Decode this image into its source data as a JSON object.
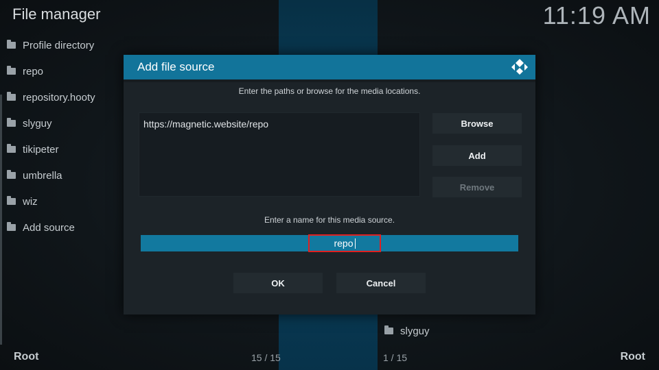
{
  "app_title": "File manager",
  "clock": "11:19 AM",
  "left_list": [
    {
      "label": "Profile directory"
    },
    {
      "label": "repo"
    },
    {
      "label": "repository.hooty"
    },
    {
      "label": "slyguy"
    },
    {
      "label": "tikipeter"
    },
    {
      "label": "umbrella"
    },
    {
      "label": "wiz"
    },
    {
      "label": "Add source"
    }
  ],
  "right_list": [
    {
      "label": "slyguy"
    }
  ],
  "footer": {
    "left_label": "Root",
    "left_count": "15 / 15",
    "right_count": "1 / 15",
    "right_label": "Root"
  },
  "dialog": {
    "title": "Add file source",
    "paths_hint": "Enter the paths or browse for the media locations.",
    "paths": [
      "https://magnetic.website/repo"
    ],
    "browse_label": "Browse",
    "add_label": "Add",
    "remove_label": "Remove",
    "name_hint": "Enter a name for this media source.",
    "name_value": "repo",
    "ok_label": "OK",
    "cancel_label": "Cancel"
  },
  "icons": {
    "folder": "folder-icon",
    "logo": "kodi-logo-icon"
  },
  "colors": {
    "accent": "#12749a",
    "highlight_border": "#e02020"
  }
}
